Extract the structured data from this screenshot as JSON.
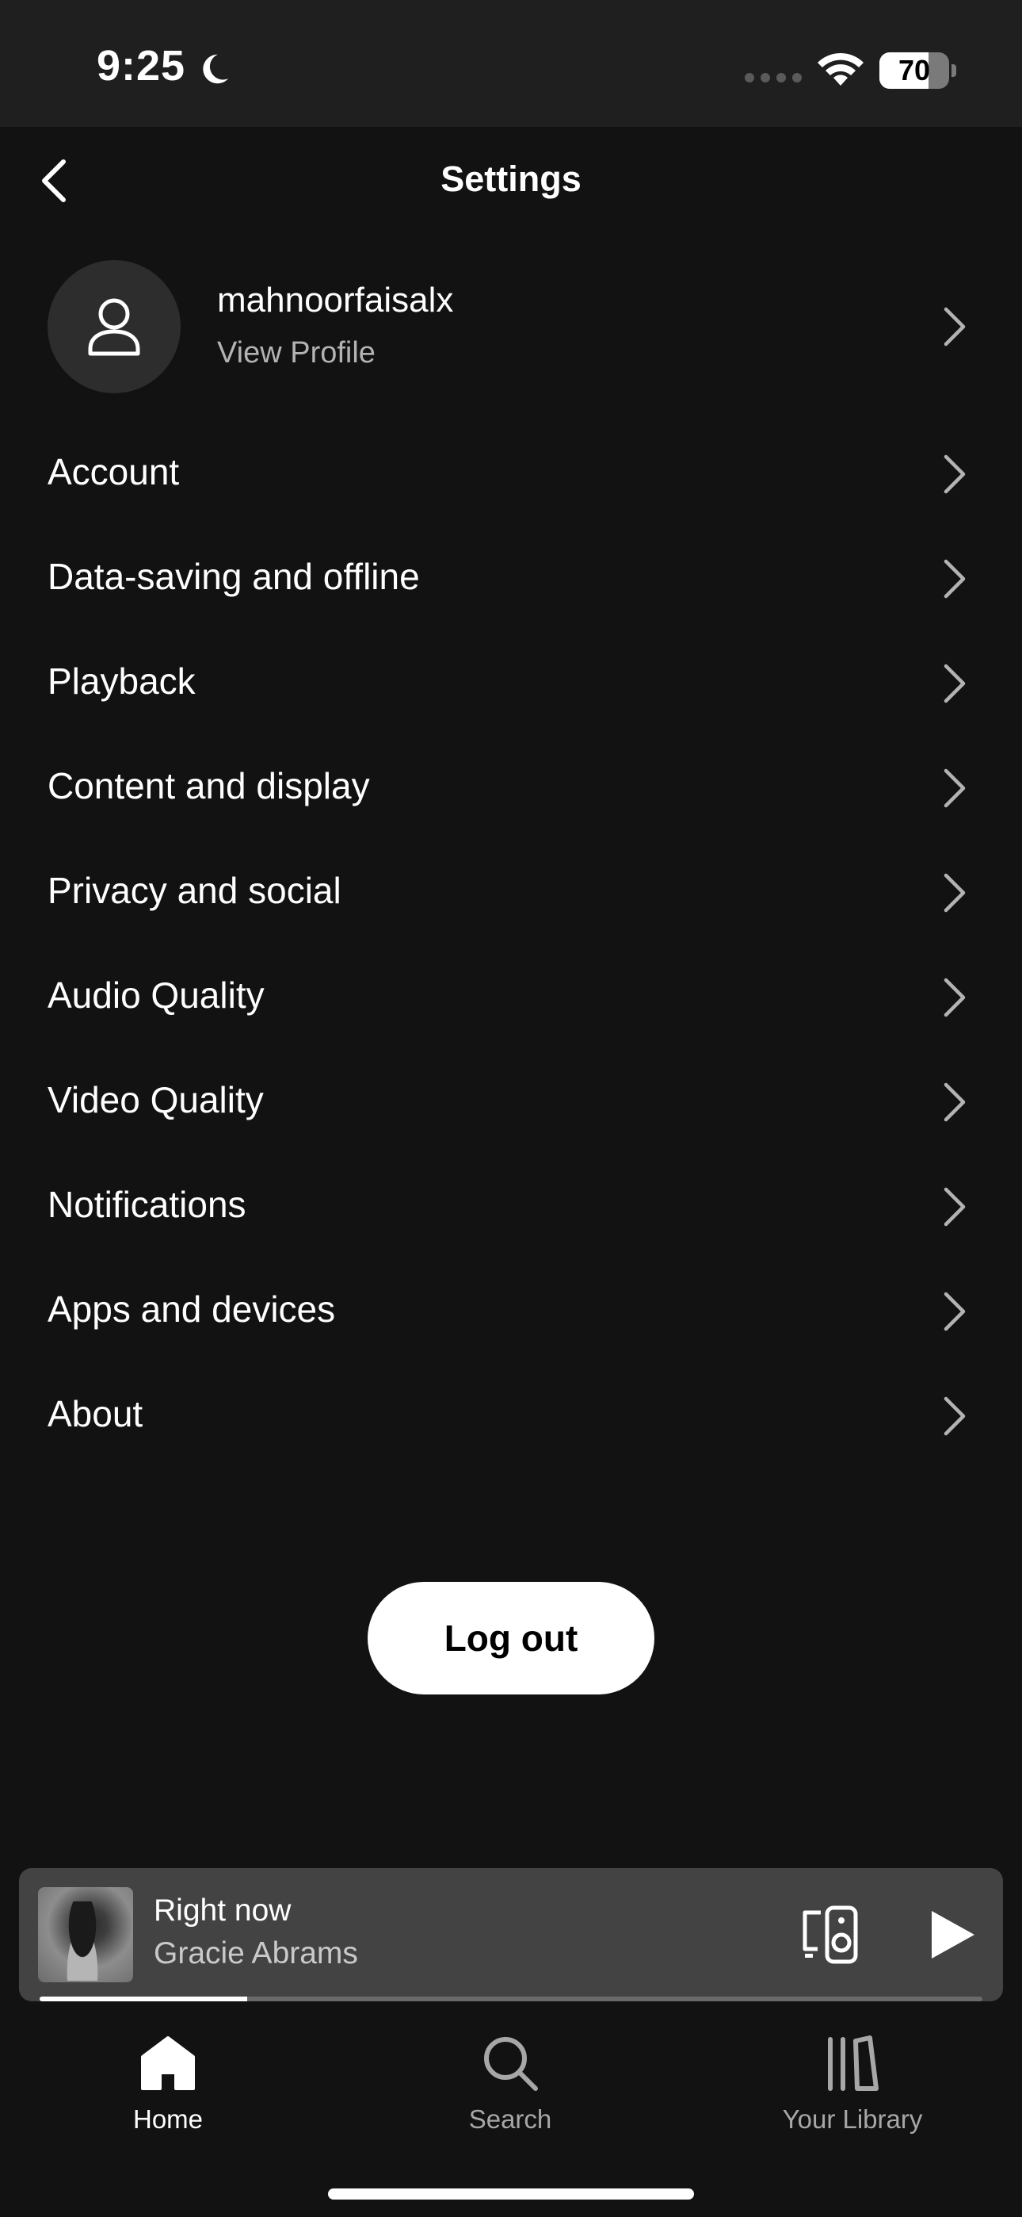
{
  "status_bar": {
    "time": "9:25",
    "battery_level": "70",
    "battery_fraction": 0.7,
    "icons": [
      "moon-icon",
      "cellular-dots-icon",
      "wifi-icon",
      "battery-icon"
    ]
  },
  "header": {
    "title": "Settings",
    "back_icon": "chevron-left-icon"
  },
  "profile": {
    "username": "mahnoorfaisalx",
    "subtitle": "View Profile",
    "avatar_icon": "user-icon"
  },
  "settings": {
    "items": [
      {
        "label": "Account"
      },
      {
        "label": "Data-saving and offline"
      },
      {
        "label": "Playback"
      },
      {
        "label": "Content and display"
      },
      {
        "label": "Privacy and social"
      },
      {
        "label": "Audio Quality"
      },
      {
        "label": "Video Quality"
      },
      {
        "label": "Notifications"
      },
      {
        "label": "Apps and devices"
      },
      {
        "label": "About"
      }
    ]
  },
  "logout_label": "Log out",
  "now_playing": {
    "title": "Right now",
    "artist": "Gracie Abrams",
    "progress_fraction": 0.22,
    "icons": [
      "connect-device-icon",
      "play-icon"
    ]
  },
  "tabs": [
    {
      "label": "Home",
      "icon": "home-icon",
      "active": true
    },
    {
      "label": "Search",
      "icon": "search-icon",
      "active": false
    },
    {
      "label": "Your Library",
      "icon": "library-icon",
      "active": false
    }
  ],
  "colors": {
    "background": "#121212",
    "status_bar": "#1f1f1f",
    "miniplayer": "#434343",
    "secondary_text": "#b3b3b3",
    "button": "#ffffff"
  }
}
